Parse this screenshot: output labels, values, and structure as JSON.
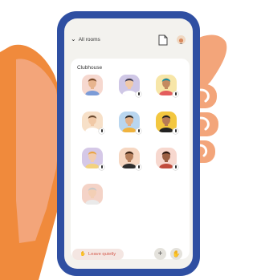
{
  "header": {
    "rooms_label": "All rooms",
    "chevron": "chevron-down-icon",
    "doc_icon": "document-icon"
  },
  "room": {
    "title": "Clubhouse"
  },
  "speakers": [
    {
      "bg": "#f6d8cf",
      "skin": "#e7b48e",
      "hair": "#7a4b2b",
      "shirt": "#7b9bd7",
      "muted": false
    },
    {
      "bg": "#cfc7e6",
      "skin": "#f0c8a8",
      "hair": "#3a3a55",
      "shirt": "#ffffff",
      "muted": true
    },
    {
      "bg": "#f7e6a8",
      "skin": "#c48a60",
      "hair": "#1b8fa3",
      "shirt": "#e35d5d",
      "muted": true
    },
    {
      "bg": "#f7e0c8",
      "skin": "#f1c9a6",
      "hair": "#6b4a30",
      "shirt": "#ffffff",
      "muted": true
    },
    {
      "bg": "#b9d6ef",
      "skin": "#e3b087",
      "hair": "#2a2a2a",
      "shirt": "#f0b33e",
      "muted": true
    },
    {
      "bg": "#f3c73f",
      "skin": "#b77a55",
      "hair": "#1f1f1f",
      "shirt": "#222222",
      "muted": true
    },
    {
      "bg": "#d5c8e7",
      "skin": "#f2ccaf",
      "hair": "#e8a446",
      "shirt": "#f3d27e",
      "muted": true
    },
    {
      "bg": "#f6d7c2",
      "skin": "#b57e5a",
      "hair": "#3b2314",
      "shirt": "#2d2d2d",
      "muted": true
    },
    {
      "bg": "#f7d8cf",
      "skin": "#9a5f43",
      "hair": "#2a1710",
      "shirt": "#c14c3d",
      "muted": true
    },
    {
      "bg": "#f4d3c7",
      "skin": "#f3cfb5",
      "hair": "#c9c9c9",
      "shirt": "#eaeaea",
      "muted": false
    }
  ],
  "footer": {
    "leave_label": "Leave quietly",
    "leave_icon": "hand-wave-icon",
    "add_icon": "plus-icon",
    "raise_icon": "raise-hand-icon"
  },
  "colors": {
    "phone": "#2f4fa2",
    "hand": "#f3a57a",
    "sleeve": "#f08a3c",
    "leave_text": "#d45a4c"
  }
}
